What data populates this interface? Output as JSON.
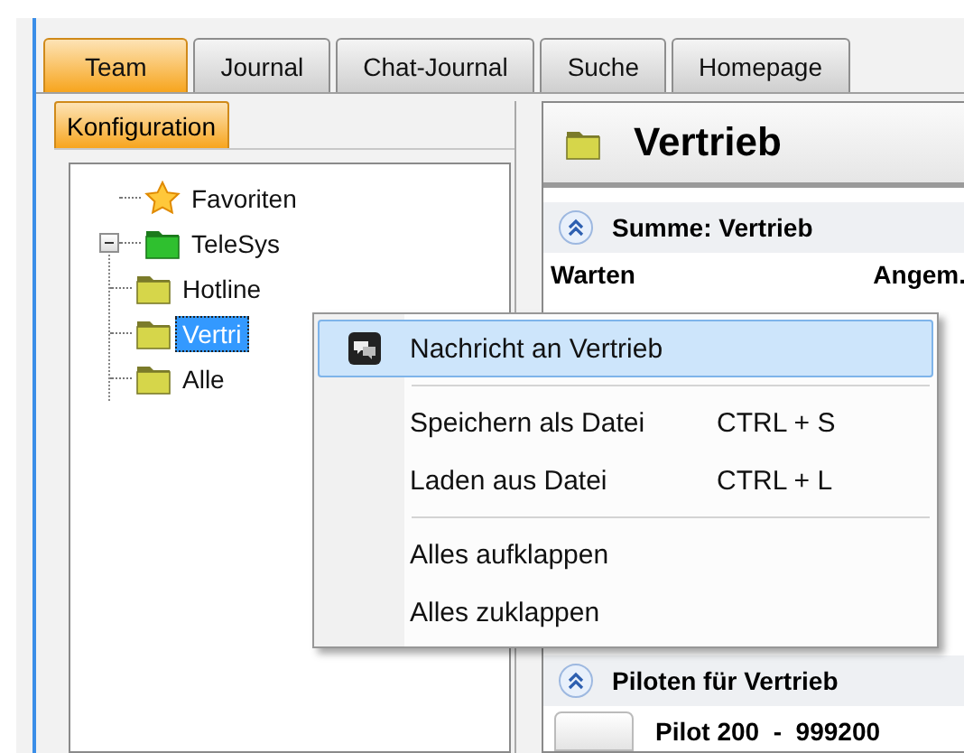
{
  "tabs": [
    {
      "label": "Team",
      "selected": true
    },
    {
      "label": "Journal",
      "selected": false
    },
    {
      "label": "Chat-Journal",
      "selected": false
    },
    {
      "label": "Suche",
      "selected": false
    },
    {
      "label": "Homepage",
      "selected": false
    }
  ],
  "left_panel": {
    "tab": {
      "label": "Konfiguration",
      "selected": true
    },
    "tree": [
      {
        "label": "Favoriten",
        "kind": "star",
        "selected": false
      },
      {
        "label": "TeleSys",
        "kind": "group",
        "expanded": true,
        "selected": false,
        "children": [
          {
            "label": "Hotline",
            "kind": "folder",
            "selected": false
          },
          {
            "label": "Vertri",
            "kind": "folder",
            "selected": true
          },
          {
            "label": "Alle",
            "kind": "folder",
            "selected": false
          }
        ]
      }
    ]
  },
  "right_panel": {
    "title": "Vertrieb",
    "sections": [
      {
        "title": "Summe: Vertrieb",
        "expanded": true,
        "columns": [
          "Warten",
          "Angem."
        ]
      },
      {
        "title": "Piloten für Vertrieb",
        "expanded": true,
        "rows": [
          "Pilot 200  -  999200"
        ]
      }
    ]
  },
  "context_menu": {
    "groups": [
      [
        {
          "label": "Nachricht an Vertrieb",
          "kind": "message",
          "selected": true
        }
      ],
      [
        {
          "label": "Speichern als Datei",
          "shortcut": "CTRL + S",
          "kind": "plain",
          "selected": false
        },
        {
          "label": "Laden aus Datei",
          "shortcut": "CTRL + L",
          "kind": "plain",
          "selected": false
        }
      ],
      [
        {
          "label": "Alles aufklappen",
          "kind": "plain",
          "selected": false
        },
        {
          "label": "Alles zuklappen",
          "kind": "plain",
          "selected": false
        }
      ]
    ]
  }
}
